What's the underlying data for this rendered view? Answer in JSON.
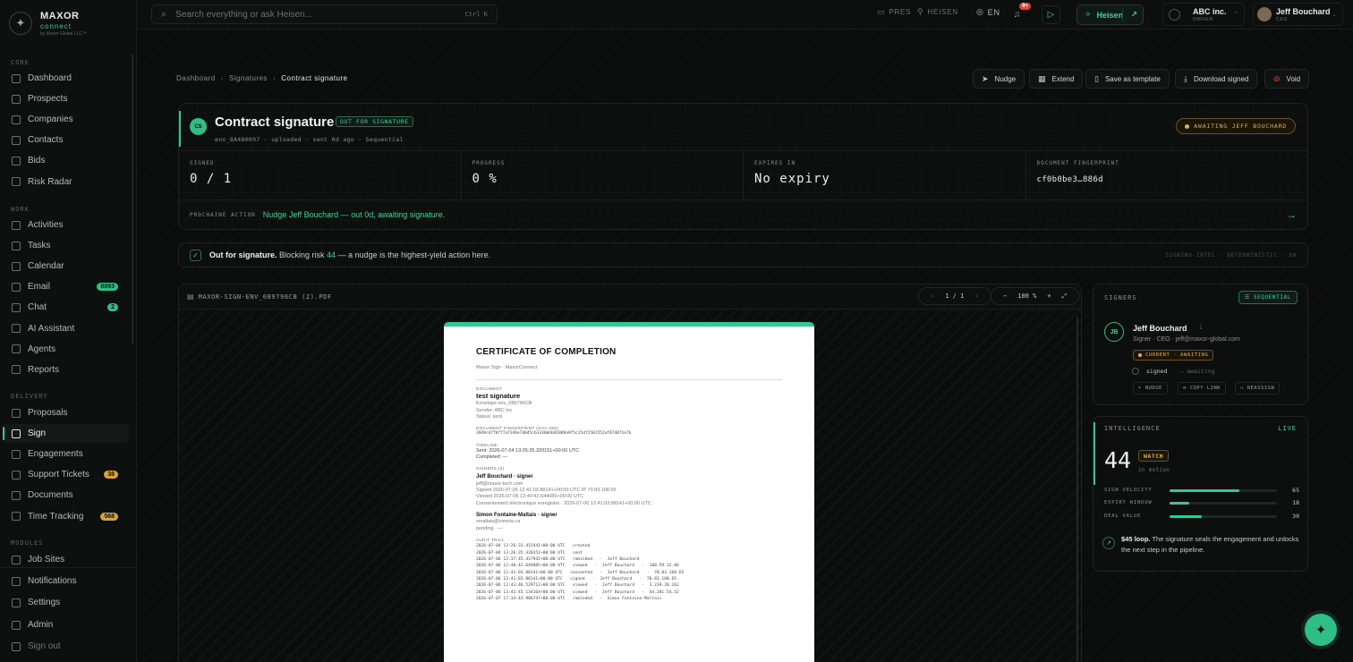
{
  "brand": {
    "name": "MAXOR",
    "sub": "connect",
    "tiny": "by Maxor Global LLC™"
  },
  "sidebar": {
    "sections": [
      {
        "title": "CORE",
        "items": [
          {
            "label": "Dashboard"
          },
          {
            "label": "Prospects"
          },
          {
            "label": "Companies"
          },
          {
            "label": "Contacts"
          },
          {
            "label": "Bids"
          },
          {
            "label": "Risk Radar"
          }
        ]
      },
      {
        "title": "WORK",
        "items": [
          {
            "label": "Activities"
          },
          {
            "label": "Tasks"
          },
          {
            "label": "Calendar"
          },
          {
            "label": "Email",
            "badge": "8893"
          },
          {
            "label": "Chat",
            "badge": "2"
          },
          {
            "label": "AI Assistant"
          },
          {
            "label": "Agents"
          },
          {
            "label": "Reports"
          }
        ]
      },
      {
        "title": "DELIVERY",
        "items": [
          {
            "label": "Proposals"
          },
          {
            "label": "Sign",
            "active": true
          },
          {
            "label": "Engagements"
          },
          {
            "label": "Support Tickets",
            "badge": "38"
          },
          {
            "label": "Documents"
          },
          {
            "label": "Time Tracking",
            "badge": "568"
          }
        ]
      },
      {
        "title": "MODULES",
        "items": [
          {
            "label": "Job Sites"
          }
        ]
      }
    ],
    "footer": [
      {
        "label": "Notifications"
      },
      {
        "label": "Settings"
      },
      {
        "label": "Admin"
      },
      {
        "label": "Sign out"
      }
    ]
  },
  "topbar": {
    "search_placeholder": "Search everything or ask Heisen...",
    "search_shortcut": "Ctrl K",
    "pres": "PRES",
    "heisen_link": "HEISEN",
    "lang": "EN",
    "bell_badge": "9+",
    "heisen_button": "Heisen",
    "org": {
      "name": "ABC inc.",
      "role": "OWNER"
    },
    "user": {
      "name": "Jeff Bouchard",
      "role": "CEO"
    }
  },
  "breadcrumb": {
    "items": [
      "Dashboard",
      "Signatures"
    ],
    "current": "Contract signature"
  },
  "actions": {
    "nudge": "Nudge",
    "extend": "Extend",
    "save_template": "Save as template",
    "download": "Download signed",
    "void": "Void"
  },
  "envelope": {
    "initials": "CS",
    "title": "Contract signature",
    "status": "OUT FOR SIGNATURE",
    "meta": "env_8A480097 · uploaded · sent 0d ago · Sequential",
    "awaiting": "AWAITING JEFF BOUCHARD",
    "stats": [
      {
        "label": "SIGNED",
        "value": "0 / 1"
      },
      {
        "label": "PROGRESS",
        "value": "0 %"
      },
      {
        "label": "EXPIRES IN",
        "value": "No expiry"
      },
      {
        "label": "DOCUMENT FINGERPRINT",
        "value": "cf0b0be3…886d"
      }
    ],
    "next_label": "PROCHAINE ACTION",
    "next_text": "Nudge Jeff Bouchard — out 0d, awaiting signature."
  },
  "banner": {
    "bold": "Out for signature.",
    "pre": " Blocking risk ",
    "risk": "44",
    "post": " — a nudge is the highest-yield action here.",
    "tag": "SIGNING-INTEL · DETERMINISTIC · $0"
  },
  "viewer": {
    "filename": "MAXOR-SIGN-ENV_089796CB (2).PDF",
    "page": "1 / 1",
    "zoom": "100 %"
  },
  "document": {
    "title": "CERTIFICATE OF COMPLETION",
    "subtitle": "Maxor Sign · MaxorConnect",
    "doc_head": "DOCUMENT",
    "doc_name": "test signature",
    "doc_lines": [
      "Envelope env_089796CB",
      "Sender: ABC inc",
      "Status: sent"
    ],
    "fp_head": "DOCUMENT FINGERPRINT (SHA-256)",
    "fp": "39d9cd7fbff7af3d6e7d045cb333004b92889a9f5c15df2581552af8748f1e7b",
    "tl_head": "TIMELINE",
    "tl_lines": [
      "Sent: 2026-07-04 13:26:35.320151+00:00 UTC",
      "Completed: —"
    ],
    "signers_head": "SIGNERS (2)",
    "signer1": "Jeff Bouchard · signer",
    "signer1_lines": [
      "jeff@maxor-tech.com",
      "Signed  2026-07-06 12:41:03.88141+00:00 UTC    IP 70.83.168.65",
      "Viewed  2026-07-06 12:40:42.644085+00:00 UTC",
      "Consentement électronique enregistré · 2026-07-06 12:41:03.88141+00:00 UTC"
    ],
    "signer2": "Simon Fontaine-Maltais · signer",
    "signer2_lines": [
      "smaltais@cimota.ca",
      "pending · —"
    ],
    "audit_head": "AUDIT TRAIL",
    "audit": "2026-07-04 13:26:33.415441+00:00 UTC   created\n2026-07-04 13:26:35.320151+00:00 UTC   sent\n2026-07-06 12:37:45.417942+00:00 UTC   reminded   ·  Jeff Bouchard\n2026-07-06 12:40:42.644085+00:00 UTC   viewed   ·  Jeff Bouchard   ·  100.59.32.86\n2026-07-06 12:41:03.88141+00:00 UTC   consented   ·  Jeff Bouchard   ·  70.83.168.65\n2026-07-06 12:41:03.88141+00:00 UTC   signed   ·  Jeff Bouchard   ·  70.83.168.65\n2026-07-06 12:43:46.529712+00:00 UTC   viewed   ·  Jeff Bouchard   ·  3.239.20.162\n2026-07-06 13:41:45.134164+00:00 UTC   viewed   ·  Jeff Bouchard   ·  44.201.54.52\n2026-07-07 17:34:43.986747+00:00 UTC   reminded   ·  Simon Fontaine-Maltais"
  },
  "signers_panel": {
    "title": "SIGNERS",
    "mode": "SEQUENTIAL",
    "signer": {
      "initials": "JB",
      "name": "Jeff Bouchard",
      "order": "1",
      "role": "Signer · CEO · jeff@maxor-global.com",
      "badge": "CURRENT · AWAITING",
      "state": "signed",
      "state2": "– awaiting"
    },
    "buttons": {
      "nudge": "NUDGE",
      "copy": "COPY LINK",
      "reassign": "REASSIGN"
    }
  },
  "intelligence": {
    "title": "INTELLIGENCE",
    "live": "LIVE",
    "score": "44",
    "verdict": "WATCH",
    "sub": "in motion",
    "metrics": [
      {
        "label": "SIGN VELOCITY",
        "value": 65
      },
      {
        "label": "EXPIRY WINDOW",
        "value": 18
      },
      {
        "label": "DEAL VALUE",
        "value": 30
      }
    ],
    "loop_bold": "$45 loop.",
    "loop_text": " The signature seals the engagement and unlocks the next step in the pipeline."
  },
  "colors": {
    "accent": "#35c794",
    "warning": "#e3b14a",
    "danger": "#e0463f",
    "background": "#0c0d0d"
  }
}
